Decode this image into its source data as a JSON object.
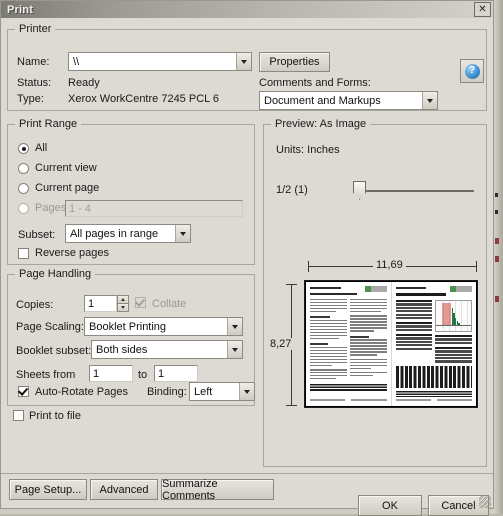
{
  "window": {
    "title": "Print",
    "close_label": "✕"
  },
  "printer": {
    "legend": "Printer",
    "name_label": "Name:",
    "name_value": "\\\\",
    "status_label": "Status:",
    "status_value": "Ready",
    "type_label": "Type:",
    "type_value": "Xerox WorkCentre 7245 PCL 6",
    "properties_button": "Properties",
    "comments_label": "Comments and Forms:",
    "comments_value": "Document and Markups",
    "help_glyph": "?"
  },
  "print_range": {
    "legend": "Print Range",
    "options": [
      {
        "label": "All",
        "selected": true,
        "enabled": true
      },
      {
        "label": "Current view",
        "selected": false,
        "enabled": true
      },
      {
        "label": "Current page",
        "selected": false,
        "enabled": true
      },
      {
        "label": "Pages",
        "selected": false,
        "enabled": true
      }
    ],
    "pages_value": "1 - 4",
    "pages_enabled": false,
    "subset_label": "Subset:",
    "subset_value": "All pages in range",
    "reverse_label": "Reverse pages",
    "reverse_checked": false
  },
  "page_handling": {
    "legend": "Page Handling",
    "copies_label": "Copies:",
    "copies_value": "1",
    "collate_label": "Collate",
    "collate_checked": true,
    "collate_enabled": false,
    "scaling_label": "Page Scaling:",
    "scaling_value": "Booklet Printing",
    "booklet_subset_label": "Booklet subset:",
    "booklet_subset_value": "Both sides",
    "sheets_from_label": "Sheets from",
    "sheets_from_value": "1",
    "sheets_to_label": "to",
    "sheets_to_value": "1",
    "auto_rotate_label": "Auto-Rotate Pages",
    "auto_rotate_checked": true,
    "binding_label": "Binding:",
    "binding_value": "Left"
  },
  "print_to_file": {
    "label": "Print to file",
    "checked": false
  },
  "preview": {
    "legend": "Preview: As Image",
    "units_label": "Units: Inches",
    "zoom_label": "1/2 (1)",
    "width_label": "11,69",
    "height_label": "8,27"
  },
  "footer": {
    "page_setup_button": "Page Setup...",
    "advanced_button": "Advanced",
    "summarize_button": "Summarize Comments",
    "ok_button": "OK",
    "cancel_button": "Cancel"
  },
  "colors": {
    "dialog_background": "#dcdad2",
    "title_bar_start": "#7c7a74",
    "title_bar_end": "#d3d1c9",
    "group_border": "#a9a69d",
    "field_background": "#ffffff",
    "disabled_text": "#a29f96"
  }
}
